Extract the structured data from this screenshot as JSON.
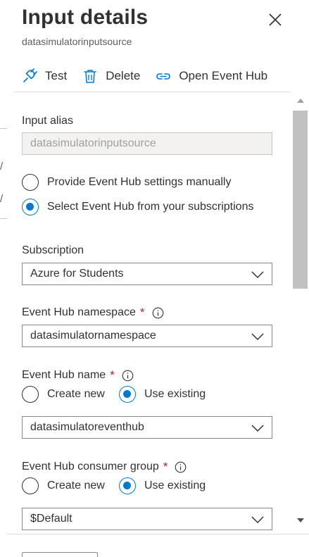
{
  "panel": {
    "title": "Input details",
    "subtitle": "datasimulatorinputsource",
    "close_icon": "close-icon"
  },
  "toolbar": {
    "test_label": "Test",
    "delete_label": "Delete",
    "open_event_hub_label": "Open Event Hub",
    "icons": [
      "plug-icon",
      "trash-icon",
      "link-icon"
    ]
  },
  "form": {
    "input_alias_label": "Input alias",
    "input_alias_value": "datasimulatorinputsource",
    "mode_options": [
      {
        "label": "Provide Event Hub settings manually",
        "selected": false
      },
      {
        "label": "Select Event Hub from your subscriptions",
        "selected": true
      }
    ],
    "subscription_label": "Subscription",
    "subscription_value": "Azure for Students",
    "namespace_label": "Event Hub namespace",
    "namespace_value": "datasimulatornamespace",
    "required_mark": "*",
    "eventhub_name_label": "Event Hub name",
    "eventhub_name_options": [
      {
        "label": "Create new",
        "selected": false
      },
      {
        "label": "Use existing",
        "selected": true
      }
    ],
    "eventhub_name_value": "datasimulatoreventhub",
    "consumer_group_label": "Event Hub consumer group",
    "consumer_group_options": [
      {
        "label": "Create new",
        "selected": false
      },
      {
        "label": "Use existing",
        "selected": true
      }
    ],
    "consumer_group_value": "$Default"
  },
  "colors": {
    "accent": "#0078d4",
    "required": "#a4262c",
    "text": "#323130",
    "muted": "#605e5c"
  }
}
